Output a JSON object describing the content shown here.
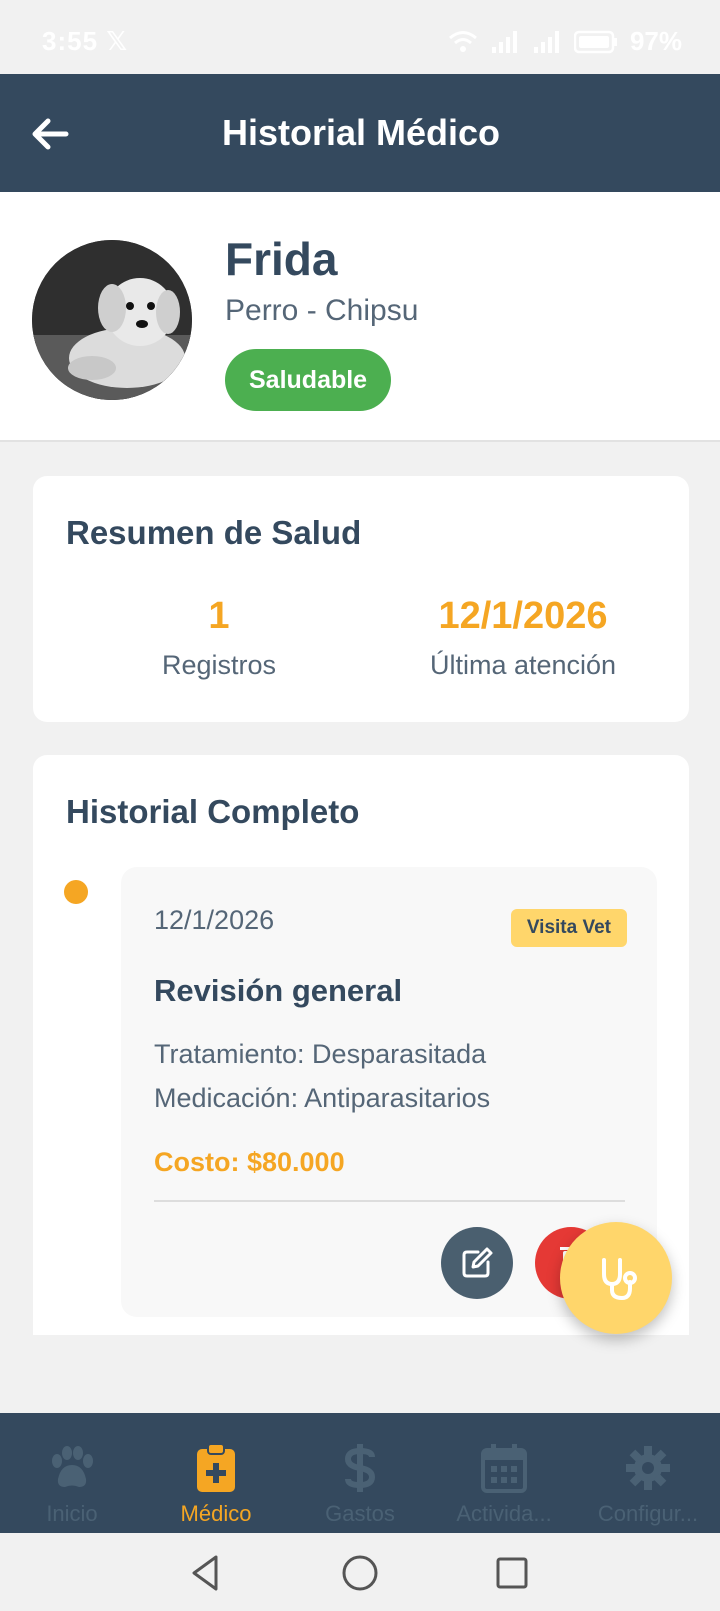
{
  "status_bar": {
    "time": "3:55",
    "battery": "97%"
  },
  "header": {
    "title": "Historial Médico"
  },
  "pet": {
    "name": "Frida",
    "breed": "Perro - Chipsu",
    "status": "Saludable"
  },
  "summary": {
    "title": "Resumen de Salud",
    "records_value": "1",
    "records_label": "Registros",
    "last_value": "12/1/2026",
    "last_label": "Última atención"
  },
  "history": {
    "title": "Historial Completo",
    "record": {
      "date": "12/1/2026",
      "type": "Visita Vet",
      "title": "Revisión general",
      "treatment": "Tratamiento: Desparasitada",
      "medication": "Medicación: Antiparasitarios",
      "cost": "Costo: $80.000"
    }
  },
  "nav": {
    "items": [
      {
        "label": "Inicio",
        "icon": "paw-icon"
      },
      {
        "label": "Médico",
        "icon": "clipboard-medical-icon"
      },
      {
        "label": "Gastos",
        "icon": "dollar-icon"
      },
      {
        "label": "Activida...",
        "icon": "calendar-icon"
      },
      {
        "label": "Configur...",
        "icon": "gear-icon"
      }
    ],
    "active_index": 1
  },
  "colors": {
    "primary": "#34495e",
    "accent": "#f5a623",
    "healthy": "#4caf50",
    "danger": "#e53935",
    "tag": "#ffd66b"
  }
}
